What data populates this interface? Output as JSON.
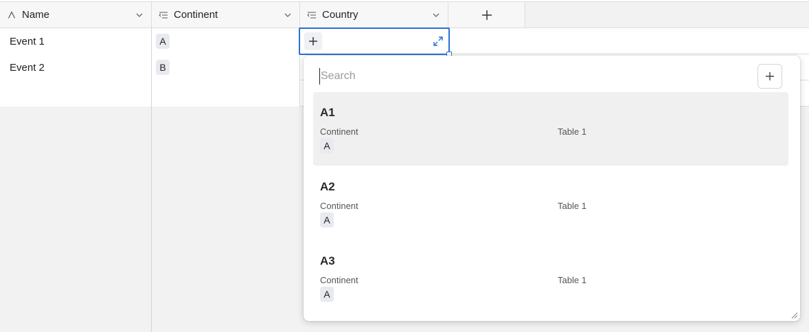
{
  "columns": [
    {
      "label": "Name",
      "icon": "text-field-icon"
    },
    {
      "label": "Continent",
      "icon": "link-field-icon"
    },
    {
      "label": "Country",
      "icon": "link-field-icon"
    }
  ],
  "add_column_icon": "plus-icon",
  "rows": [
    {
      "name": "Event 1",
      "continent": "A"
    },
    {
      "name": "Event 2",
      "continent": "B"
    }
  ],
  "dropdown": {
    "search_placeholder": "Search",
    "search_value": "",
    "options": [
      {
        "title": "A1",
        "field_label": "Continent",
        "table": "Table 1",
        "value": "A"
      },
      {
        "title": "A2",
        "field_label": "Continent",
        "table": "Table 1",
        "value": "A"
      },
      {
        "title": "A3",
        "field_label": "Continent",
        "table": "Table 1",
        "value": "A"
      }
    ]
  },
  "colors": {
    "accent": "#2a6fd6",
    "chip_bg": "#e8eaf0",
    "hover_bg": "#f0f0f0"
  }
}
